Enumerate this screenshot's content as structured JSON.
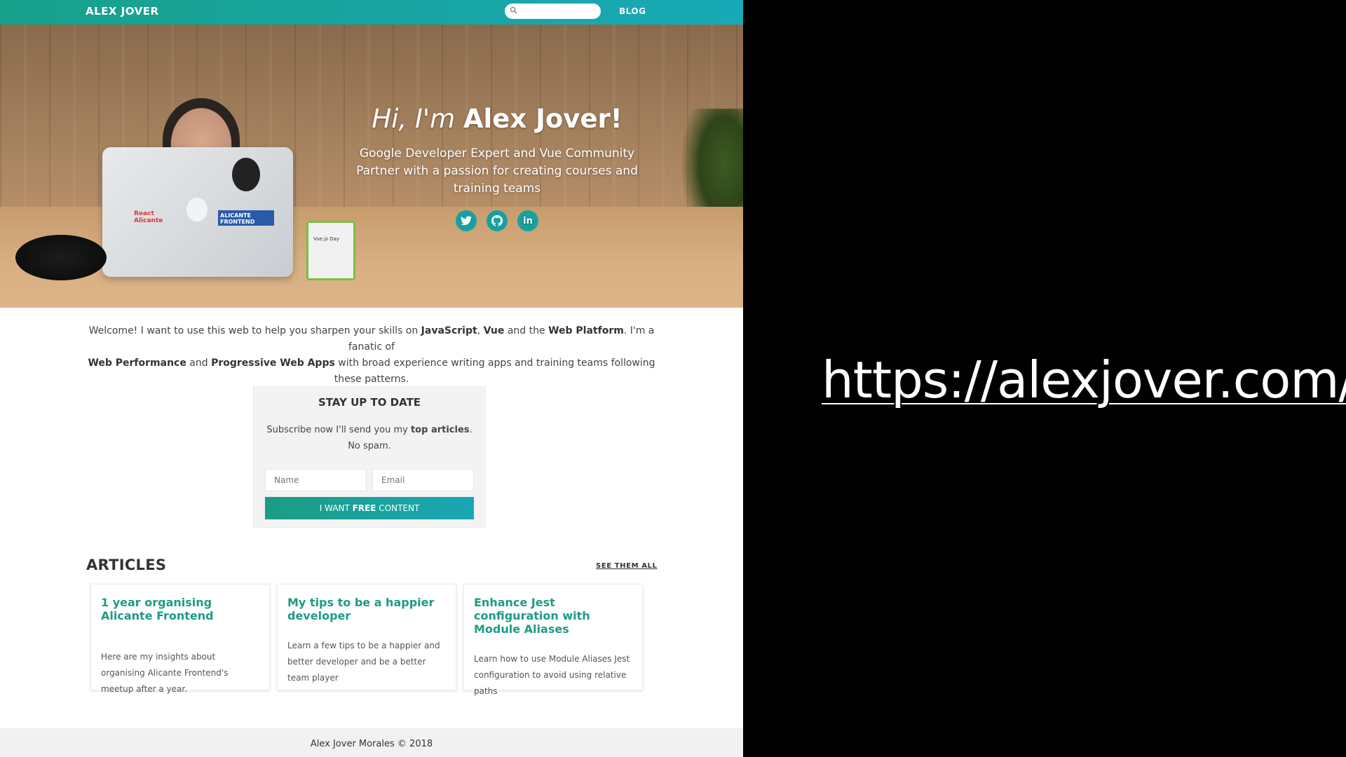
{
  "nav": {
    "brand": "ALEX JOVER",
    "search_placeholder": "",
    "blog_label": "BLOG"
  },
  "hero": {
    "greeting": "Hi, I'm ",
    "name": "Alex Jover",
    "exclamation": "!",
    "subtitle": "Google Developer Expert and Vue Community Partner with a passion for creating courses and training teams",
    "socials": [
      {
        "name": "twitter-icon",
        "glyph": "t"
      },
      {
        "name": "github-icon",
        "glyph": "◉"
      },
      {
        "name": "linkedin-icon",
        "glyph": "in"
      }
    ]
  },
  "intro": {
    "t1": "Welcome! I want to use this web to help you sharpen your skills on ",
    "b1": "JavaScript",
    "t2": ", ",
    "b2": "Vue",
    "t3": " and the ",
    "b3": "Web Platform",
    "t4": ". I'm a fanatic of ",
    "b4": "Web Performance",
    "t5": " and ",
    "b5": "Progressive Web Apps",
    "t6": " with broad experience writing apps and training teams following these patterns."
  },
  "subscribe": {
    "title": "STAY UP TO DATE",
    "text_before": "Subscribe now I'll send you my ",
    "text_bold": "top articles",
    "text_after": ". No spam.",
    "name_placeholder": "Name",
    "email_placeholder": "Email",
    "cta_pre": "I WANT ",
    "cta_bold": "FREE",
    "cta_post": " CONTENT"
  },
  "articles": {
    "heading": "ARTICLES",
    "see_all": "SEE THEM ALL",
    "items": [
      {
        "title": "1 year organising Alicante Frontend",
        "excerpt": "Here are my insights about organising Alicante Frontend's meetup after a year."
      },
      {
        "title": "My tips to be a happier developer",
        "excerpt": "Learn a few tips to be a happier and better developer and be a better team player"
      },
      {
        "title": "Enhance Jest configuration with Module Aliases",
        "excerpt": "Learn how to use Module Aliases Jest configuration to avoid using relative paths"
      }
    ]
  },
  "footer": {
    "text": "Alex Jover Morales © 2018"
  },
  "slide": {
    "url": "https://alexjover.com/"
  },
  "colors": {
    "accent": "#18a9b7",
    "green": "#1d9c82",
    "background": "#000000"
  }
}
